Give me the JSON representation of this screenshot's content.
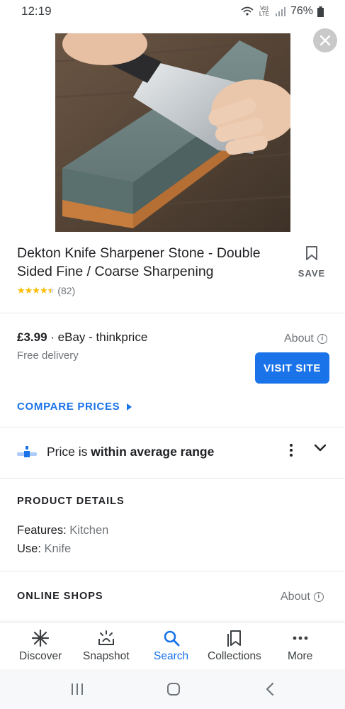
{
  "status": {
    "time": "12:19",
    "network": "Vo) LTE",
    "battery": "76%"
  },
  "product": {
    "title": "Dekton Knife Sharpener Stone - Double Sided Fine / Coarse Sharpening",
    "rating": 4.5,
    "reviews": "(82)",
    "save_label": "SAVE"
  },
  "offer": {
    "price": "£3.99",
    "seller": "· eBay - thinkprice",
    "delivery": "Free delivery",
    "about": "About",
    "visit_label": "VISIT SITE",
    "compare_label": "COMPARE PRICES"
  },
  "price_insight": {
    "prefix": "Price is ",
    "bold": "within average range"
  },
  "details": {
    "heading": "PRODUCT DETAILS",
    "features_label": "Features:",
    "features_value": "Kitchen",
    "use_label": "Use:",
    "use_value": "Knife"
  },
  "shops": {
    "heading": "ONLINE SHOPS",
    "about": "About"
  },
  "nav": {
    "items": [
      {
        "label": "Discover",
        "icon": "asterisk-icon"
      },
      {
        "label": "Snapshot",
        "icon": "snapshot-icon"
      },
      {
        "label": "Search",
        "icon": "search-icon"
      },
      {
        "label": "Collections",
        "icon": "collections-icon"
      },
      {
        "label": "More",
        "icon": "more-icon"
      }
    ],
    "active": "Search"
  },
  "colors": {
    "accent": "#1a73e8",
    "star": "#fbbc04"
  }
}
